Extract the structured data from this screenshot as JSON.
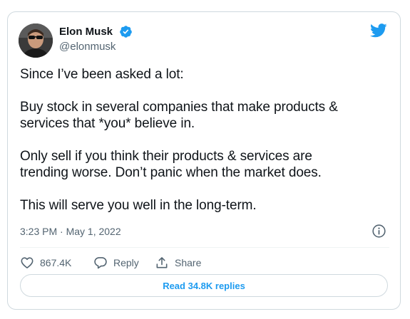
{
  "author": {
    "name": "Elon Musk",
    "handle": "@elonmusk",
    "verified": true,
    "avatar_icon": "profile-photo-avatar"
  },
  "brand": {
    "logo_icon": "twitter-bird-icon",
    "accent_color": "#1d9bf0"
  },
  "tweet": {
    "paragraphs": [
      [
        "Since I’ve been asked a lot:"
      ],
      [
        "Buy stock in several companies that make products &",
        "services that *you* believe in."
      ],
      [
        "Only sell if you think their products & services are",
        "trending worse. Don’t panic when the market does."
      ],
      [
        "This will serve you well in the long-term."
      ]
    ],
    "timestamp": "3:23 PM · May 1, 2022"
  },
  "actions": {
    "like_count": "867.4K",
    "reply_label": "Reply",
    "share_label": "Share"
  },
  "footer": {
    "read_replies_label": "Read 34.8K replies"
  },
  "icons": {
    "info": "info-icon",
    "like": "heart-icon",
    "reply": "reply-icon",
    "share": "share-icon",
    "verified": "verified-badge-icon"
  }
}
